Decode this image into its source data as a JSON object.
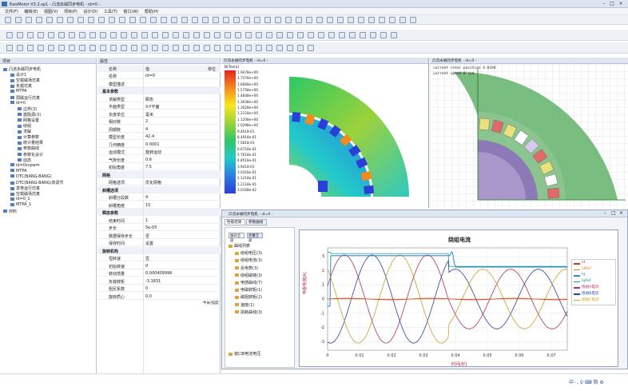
{
  "window": {
    "title": "EasiMotor V3.2.sp1 - 凸流永磁同步电机 - id=0 -"
  },
  "menu": [
    "文件(F)",
    "编辑(E)",
    "视图(V)",
    "项目(P)",
    "设计(D)",
    "工具(T)",
    "窗口(W)",
    "帮助(H)"
  ],
  "tree": {
    "header": "项目",
    "items": [
      {
        "label": "凸流永磁同步电机",
        "level": 0
      },
      {
        "label": "设计1",
        "level": 1
      },
      {
        "label": "空载磁场仿真",
        "level": 1
      },
      {
        "label": "负载仿真",
        "level": 1
      },
      {
        "label": "MTPA",
        "level": 1
      },
      {
        "label": "弱磁运行仿真",
        "level": 1
      },
      {
        "label": "id=0",
        "level": 1
      },
      {
        "label": "边界(3)",
        "level": 2
      },
      {
        "label": "激励源(3)",
        "level": 2
      },
      {
        "label": "网格设置",
        "level": 2
      },
      {
        "label": "绕组",
        "level": 2
      },
      {
        "label": "求解",
        "level": 2
      },
      {
        "label": "计算参数",
        "level": 2
      },
      {
        "label": "统计量结果",
        "level": 2
      },
      {
        "label": "参数曲线",
        "level": 2
      },
      {
        "label": "参数化设计",
        "level": 2
      },
      {
        "label": "动态",
        "level": 2
      },
      {
        "label": "id=0svpwm",
        "level": 1
      },
      {
        "label": "MTPA",
        "level": 1
      },
      {
        "label": "DTC(BANG-BANG)",
        "level": 1
      },
      {
        "label": "DTC(BANG-BANG)双调节",
        "level": 1
      },
      {
        "label": "发电运行仿真",
        "level": 1
      },
      {
        "label": "空载磁场仿真",
        "level": 1
      },
      {
        "label": "id=0_1",
        "level": 1
      },
      {
        "label": "MTPA_1",
        "level": 1
      },
      {
        "label": "材料",
        "level": 0
      }
    ]
  },
  "props": {
    "header": "属性",
    "col_name": "名称",
    "col_value": "值",
    "col_unit": "单位",
    "rows": [
      {
        "k": "名称",
        "v": "id=0",
        "sec": false
      },
      {
        "k": "模型描述",
        "v": "",
        "sec": false
      },
      {
        "k": "基本参数",
        "v": "",
        "sec": true
      },
      {
        "k": "求解类型",
        "v": "瞬态",
        "sec": false
      },
      {
        "k": "平面类型",
        "v": "X-Y平面",
        "sec": false
      },
      {
        "k": "长度单位",
        "v": "毫米",
        "sec": false
      },
      {
        "k": "相对数",
        "v": "2",
        "sec": false
      },
      {
        "k": "周期数",
        "v": "4",
        "sec": false
      },
      {
        "k": "模型长度",
        "v": "42.4",
        "sec": false
      },
      {
        "k": "几何精度",
        "v": "0.0001",
        "sec": false
      },
      {
        "k": "运动模式",
        "v": "旋转运动",
        "sec": false
      },
      {
        "k": "气隙长度",
        "v": "0.6",
        "sec": false
      },
      {
        "k": "初始角度",
        "v": "7.5",
        "sec": false
      },
      {
        "k": "网格",
        "v": "",
        "sec": true
      },
      {
        "k": "网格选项",
        "v": "优化网格",
        "sec": false
      },
      {
        "k": "斜槽选项",
        "v": "",
        "sec": true
      },
      {
        "k": "斜槽分段数",
        "v": "4",
        "sec": false
      },
      {
        "k": "斜槽角度",
        "v": "15",
        "sec": false
      },
      {
        "k": "瞬态参数",
        "v": "",
        "sec": true
      },
      {
        "k": "结束时间",
        "v": "1",
        "sec": false
      },
      {
        "k": "步长",
        "v": "5e-05",
        "sec": false
      },
      {
        "k": "数据保存步长",
        "v": "否",
        "sec": false
      },
      {
        "k": "保存时间",
        "v": "设置",
        "sec": false
      },
      {
        "k": "旋转机构",
        "v": "",
        "sec": true
      },
      {
        "k": "恒转速",
        "v": "否",
        "sec": false
      },
      {
        "k": "初始转速",
        "v": "0",
        "sec": false
      },
      {
        "k": "转动惯量",
        "v": "0.000409996",
        "sec": false
      },
      {
        "k": "负载转矩",
        "v": "-3.1831",
        "sec": false
      },
      {
        "k": "阻尼系数",
        "v": "0",
        "sec": false
      },
      {
        "k": "旋转质心",
        "v": "0,0",
        "sec": false
      }
    ],
    "unit_hint": "牛米/弧度"
  },
  "view1": {
    "title": "凸流永磁同步电机 - id=0 -",
    "legend_title": "B[Tesla]",
    "legend_values": [
      "1.9478e+00",
      "1.7378e+00",
      "1.6668e+00",
      "1.5758e+00",
      "1.4848e+00",
      "1.3938e+00",
      "1.3028e+00",
      "1.2118e+00",
      "1.1208e+00",
      "1.0298e+00",
      "9.4018-01",
      "8.4918e-01",
      "7.5818-01",
      "6.6718e-01",
      "5.7618e-01",
      "4.8518e-01",
      "3.9418-01",
      "3.0318e-01",
      "2.1218e-01",
      "1.2118e-01",
      "3.0168e-02"
    ]
  },
  "view2": {
    "title": "凸流永磁同步电机 - id=0 -",
    "readout1": "current rotor position 4.8194",
    "readout2": "current speed 0 rpm"
  },
  "plotwin": {
    "title": "凸流永磁同步电机 - id=0 -",
    "tabs": [
      "性能结果",
      "参数曲线"
    ],
    "btn_expand": "展开全部",
    "btn_collapse": "折叠全部",
    "list": [
      {
        "label": "曲线列表",
        "level": 0
      },
      {
        "label": "绕组电压(3)",
        "level": 1
      },
      {
        "label": "绕组电流(3)",
        "level": 1
      },
      {
        "label": "反电势(3)",
        "level": 1
      },
      {
        "label": "绕组磁链(3)",
        "level": 1
      },
      {
        "label": "电感曲线(7)",
        "level": 1
      },
      {
        "label": "电磁转矩(1)",
        "level": 1
      },
      {
        "label": "磁阻转矩(2)",
        "level": 1
      },
      {
        "label": "速度(1)",
        "level": 1
      },
      {
        "label": "损耗曲线(3)",
        "level": 1
      },
      {
        "label": "窗口B电流电压",
        "level": 0
      }
    ]
  },
  "chart_data": {
    "type": "line",
    "title": "绕组电流",
    "xlabel": "时间[秒]",
    "ylabel": "电枢电流[A]",
    "xlim": [
      0,
      0.075
    ],
    "ylim": [
      -3.6,
      3.6
    ],
    "xticks": [
      "0",
      "0.01",
      "0.02",
      "0.03",
      "0.04",
      "0.05",
      "0.06",
      "0.07"
    ],
    "yticks": [
      "3",
      "2",
      "1",
      "0",
      "-1",
      "-2",
      "-3"
    ],
    "legend_position": "right",
    "legend": [
      "Id",
      "IdRef",
      "Iq",
      "IqRef",
      "绕组A电流",
      "绕组B电流",
      "绕组C电流"
    ],
    "colors": {
      "Id": "#c0392b",
      "IdRef": "#e67e22",
      "Iq": "#2e86de",
      "IqRef": "#16a085",
      "A": "#b03060",
      "B": "#2c3e9e",
      "C": "#c9a227"
    }
  },
  "status": {
    "ime": "中 ·, ♀ ⌨ 简 ⚙"
  }
}
